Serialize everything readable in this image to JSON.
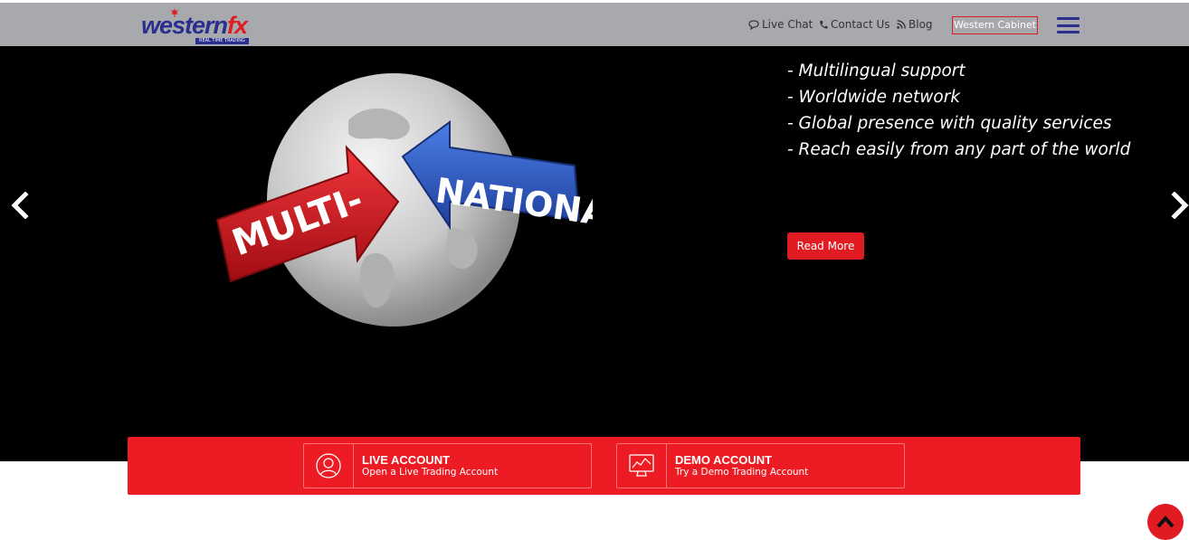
{
  "brand": {
    "logo_part1": "western",
    "logo_part2": "fx",
    "tagline": "REAL TIME TRADING",
    "colors": {
      "navy": "#2a2f8f",
      "red": "#e11b22"
    }
  },
  "header": {
    "nav": [
      {
        "label": "Live Chat",
        "icon": "chat-icon"
      },
      {
        "label": "Contact Us",
        "icon": "phone-icon"
      },
      {
        "label": "Blog",
        "icon": "rss-icon"
      }
    ],
    "cabinet_label": "Western Cabinet",
    "menu_icon": "hamburger-icon"
  },
  "hero": {
    "banner_left": "MULTI-",
    "banner_right": "NATIONAL",
    "features": [
      "- Multilingual support",
      "- Worldwide network",
      "- Global presence with quality services",
      "- Reach easily from any part of the world"
    ],
    "cta_label": "Read More",
    "prev_icon": "chevron-left-icon",
    "next_icon": "chevron-right-icon"
  },
  "accounts": [
    {
      "title": "LIVE ACCOUNT",
      "subtitle": "Open a Live Trading Account",
      "icon": "user-icon"
    },
    {
      "title": "DEMO ACCOUNT",
      "subtitle": "Try a Demo Trading Account",
      "icon": "monitor-icon"
    }
  ],
  "back_to_top_icon": "chevron-up-icon"
}
